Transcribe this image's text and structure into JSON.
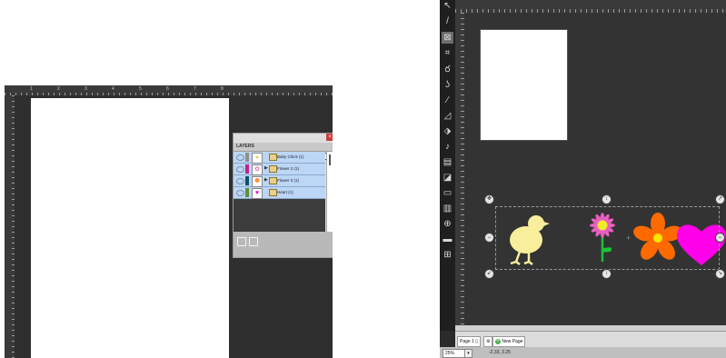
{
  "left": {
    "ruler_numbers": [
      "1",
      "2",
      "3",
      "4",
      "5",
      "6",
      "7",
      "8"
    ],
    "layers_panel": {
      "title": "LAYERS",
      "close_glyph": "×",
      "layers": [
        {
          "name": "Baby Chick (1)",
          "swatch": "#8f8f8f",
          "thumb": "chick",
          "thumb_color": "#f7e89a",
          "grouped": false
        },
        {
          "name": "Flower 2 (1)",
          "swatch": "#c0208a",
          "thumb": "daisy",
          "thumb_color": "#e86fb0",
          "grouped": true
        },
        {
          "name": "Flower 2 (1)",
          "swatch": "#0d4f6b",
          "thumb": "flower",
          "thumb_color": "#ff6a00",
          "grouped": true
        },
        {
          "name": "Heart (1)",
          "swatch": "#5a8f3a",
          "thumb": "heart",
          "thumb_color": "#ff00cc",
          "grouped": false
        }
      ]
    }
  },
  "right": {
    "tools": [
      "pointer",
      "pen",
      "select",
      "crop",
      "lasso",
      "hook",
      "brush",
      "ruler",
      "eraser",
      "dropper",
      "text",
      "shape",
      "node",
      "columns",
      "zoom",
      "keyboard",
      "grid"
    ],
    "pages": {
      "tab1": "Page 1",
      "new_page": "New Page"
    },
    "status": {
      "zoom": "25%",
      "zoom_arrow": "▾",
      "coords": "-2.33, 3.25"
    },
    "colors": {
      "chick": "#f9ee9c",
      "daisy_petals": "#e85fc0",
      "daisy_center": "#f3ea2a",
      "stem": "#19c23a",
      "flower": "#ff6a00",
      "flower_center": "#f7e600",
      "heart": "#ff00e8"
    }
  }
}
